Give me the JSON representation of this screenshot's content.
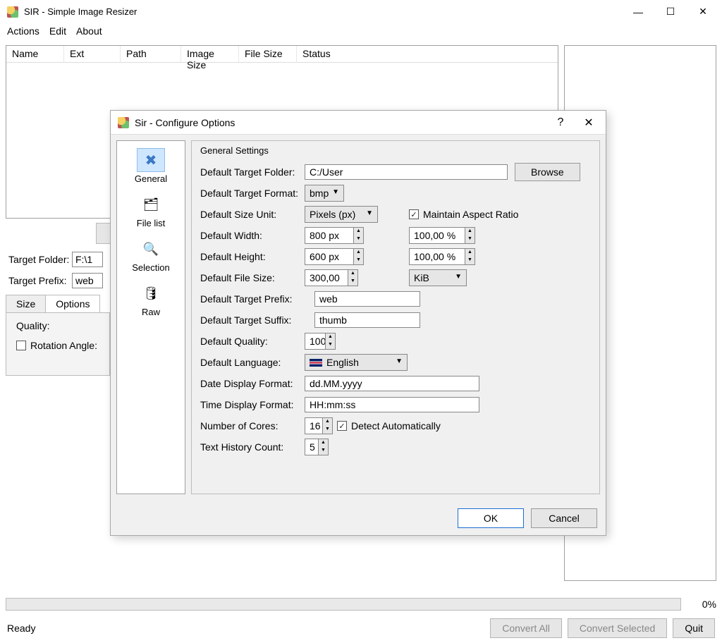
{
  "main": {
    "title": "SIR - Simple Image Resizer",
    "menu": {
      "actions": "Actions",
      "edit": "Edit",
      "about": "About"
    },
    "columns": {
      "name": "Name",
      "ext": "Ext",
      "path": "Path",
      "image_size": "Image Size",
      "file_size": "File Size",
      "status": "Status"
    },
    "target_folder_label": "Target Folder:",
    "target_folder_value": "F:\\1",
    "target_prefix_label": "Target Prefix:",
    "target_prefix_value": "web",
    "tabs": {
      "size": "Size",
      "options": "Options"
    },
    "options_panel": {
      "quality_label": "Quality:",
      "rotation_label": "Rotation Angle:"
    },
    "progress_pct": "0%",
    "status_text": "Ready",
    "buttons": {
      "convert_all": "Convert All",
      "convert_selected": "Convert Selected",
      "quit": "Quit"
    }
  },
  "dialog": {
    "title": "Sir - Configure Options",
    "categories": {
      "general": "General",
      "filelist": "File list",
      "selection": "Selection",
      "raw": "Raw"
    },
    "group_title": "General Settings",
    "fields": {
      "default_target_folder": "Default Target Folder:",
      "default_target_folder_value": "C:/User",
      "browse": "Browse",
      "default_target_format": "Default Target Format:",
      "format_value": "bmp",
      "default_size_unit": "Default Size Unit:",
      "size_unit_value": "Pixels (px)",
      "maintain_aspect": "Maintain Aspect Ratio",
      "default_width": "Default Width:",
      "width_value": "800 px",
      "width_pct": "100,00 %",
      "default_height": "Default Height:",
      "height_value": "600 px",
      "height_pct": "100,00 %",
      "default_file_size": "Default File Size:",
      "file_size_value": "300,00",
      "file_size_unit": "KiB",
      "default_target_prefix": "Default Target Prefix:",
      "prefix_value": "web",
      "default_target_suffix": "Default Target Suffix:",
      "suffix_value": "thumb",
      "default_quality": "Default Quality:",
      "quality_value": "100",
      "default_language": "Default Language:",
      "language_value": "English",
      "date_format": "Date Display Format:",
      "date_value": "dd.MM.yyyy",
      "time_format": "Time Display Format:",
      "time_value": "HH:mm:ss",
      "cores": "Number of Cores:",
      "cores_value": "16",
      "detect_auto": "Detect Automatically",
      "history": "Text History Count:",
      "history_value": "5"
    },
    "buttons": {
      "ok": "OK",
      "cancel": "Cancel"
    }
  }
}
